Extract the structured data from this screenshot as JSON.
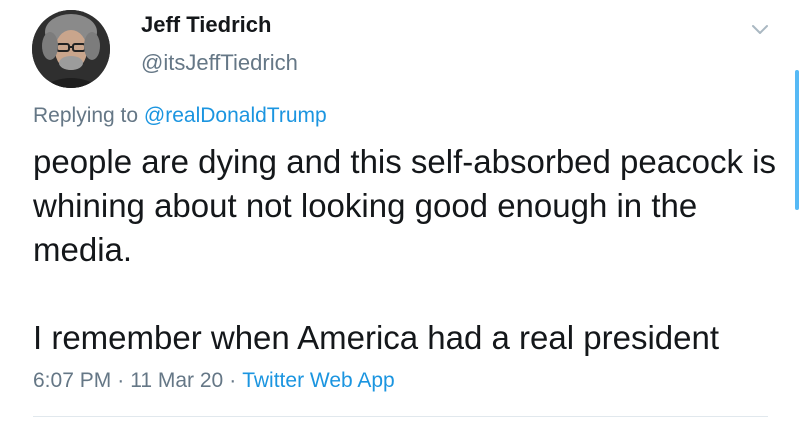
{
  "tweet": {
    "author": {
      "display_name": "Jeff Tiedrich",
      "handle": "@itsJeffTiedrich",
      "avatar_icon": "profile-photo"
    },
    "menu_icon": "chevron-down-icon",
    "reply_context": {
      "prefix": "Replying to",
      "mention": "@realDonaldTrump"
    },
    "text": {
      "paragraph_1": "people are dying and this self-absorbed peacock is whining about not looking good enough in the media.",
      "paragraph_2": "I remember when America had a real president"
    },
    "meta": {
      "time": "6:07 PM",
      "separator": "·",
      "date": "11 Mar 20",
      "source": "Twitter Web App"
    }
  },
  "colors": {
    "text": "#14171a",
    "secondary": "#657786",
    "link": "#1b95e0",
    "divider": "#e1e8ed"
  }
}
